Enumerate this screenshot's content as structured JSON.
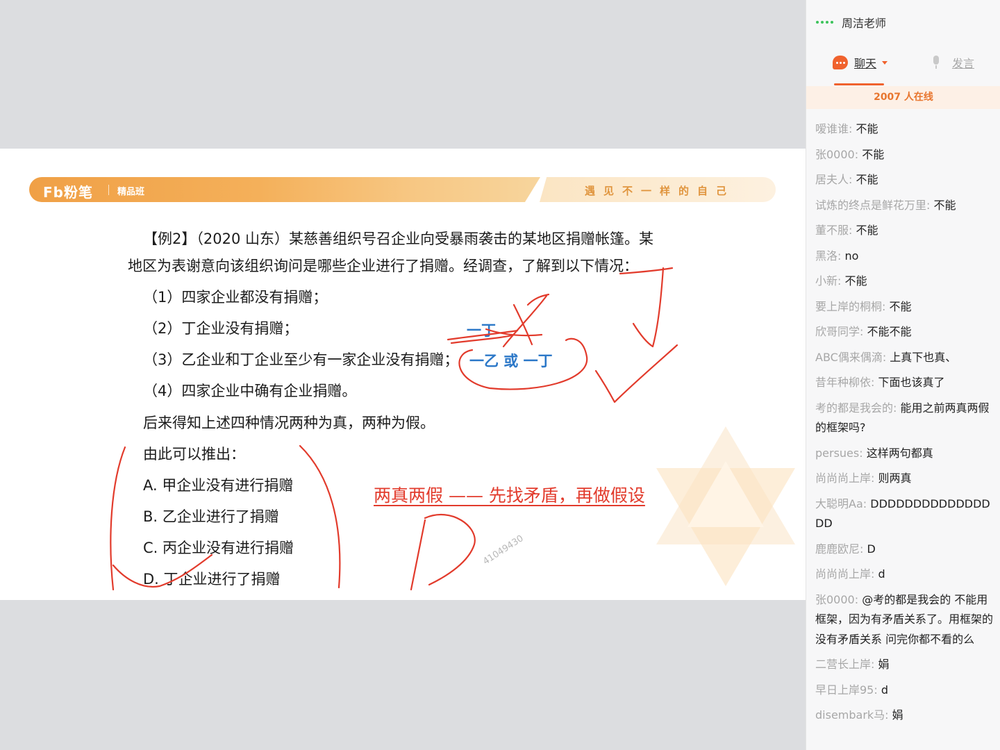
{
  "slide": {
    "logo": "Fb粉笔",
    "class_name": "精品班",
    "slogan": "遇见不一样的自己",
    "question_line1": "【例2】（2020 山东）某慈善组织号召企业向受暴雨袭击的某地区捐赠帐篷。某",
    "question_line2": "地区为表谢意向该组织询问是哪些企业进行了捐赠。经调查，了解到以下情况：",
    "conditions": [
      "（1）四家企业都没有捐赠；",
      "（2）丁企业没有捐赠；",
      "（3）乙企业和丁企业至少有一家企业没有捐赠；",
      "（4）四家企业中确有企业捐赠。"
    ],
    "statement": "后来得知上述四种情况两种为真，两种为假。",
    "prompt": "由此可以推出：",
    "options": [
      "A. 甲企业没有进行捐赠",
      "B. 乙企业进行了捐赠",
      "C. 丙企业没有进行捐赠",
      "D. 丁企业进行了捐赠"
    ],
    "watermark": "41049430",
    "annotations": {
      "blue_ding": "一丁",
      "blue_yi_or_ding": "一乙 或 一丁",
      "red_note": "两真两假 —— 先找矛盾，再做假设"
    },
    "colors": {
      "banner_orange": "#f0a046",
      "annotation_red": "#e23b2c",
      "annotation_blue": "#2c78c8"
    }
  },
  "panel": {
    "teacher_name": "周洁老师",
    "tabs": {
      "chat": "聊天",
      "speak": "发言"
    },
    "online": "2007 人在线",
    "icons": [
      "signal-icon",
      "chat-bubble-icon",
      "caret-icon",
      "mic-icon"
    ],
    "messages": [
      {
        "user": "嗳谁谁:",
        "text": " 不能"
      },
      {
        "user": "张0000:",
        "text": " 不能"
      },
      {
        "user": "居夫人:",
        "text": " 不能"
      },
      {
        "user": "试炼的终点是鲜花万里:",
        "text": " 不能"
      },
      {
        "user": "董不服:",
        "text": " 不能"
      },
      {
        "user": "黑洛:",
        "text": " no"
      },
      {
        "user": "小新:",
        "text": " 不能"
      },
      {
        "user": "要上岸的桐桐:",
        "text": " 不能"
      },
      {
        "user": "欣哥同学:",
        "text": " 不能不能"
      },
      {
        "user": "ABC偶来偶滴:",
        "text": " 上真下也真、"
      },
      {
        "user": "昔年种柳依:",
        "text": " 下面也该真了"
      },
      {
        "user": "考的都是我会的:",
        "text": " 能用之前两真两假的框架吗?"
      },
      {
        "user": "persues:",
        "text": " 这样两句都真"
      },
      {
        "user": "尚尚尚上岸:",
        "text": " 则两真"
      },
      {
        "user": "大聪明Aa:",
        "text": " DDDDDDDDDDDDDDDD"
      },
      {
        "user": "鹿鹿欧尼:",
        "text": " D"
      },
      {
        "user": "尚尚尚上岸:",
        "text": " d"
      },
      {
        "user": "张0000:",
        "text": " @考的都是我会的 不能用框架，因为有矛盾关系了。用框架的没有矛盾关系 问完你都不看的么"
      },
      {
        "user": "二营长上岸:",
        "text": " 娟"
      },
      {
        "user": "早日上岸95:",
        "text": " d"
      },
      {
        "user": "disembark马:",
        "text": " 娟"
      }
    ]
  }
}
